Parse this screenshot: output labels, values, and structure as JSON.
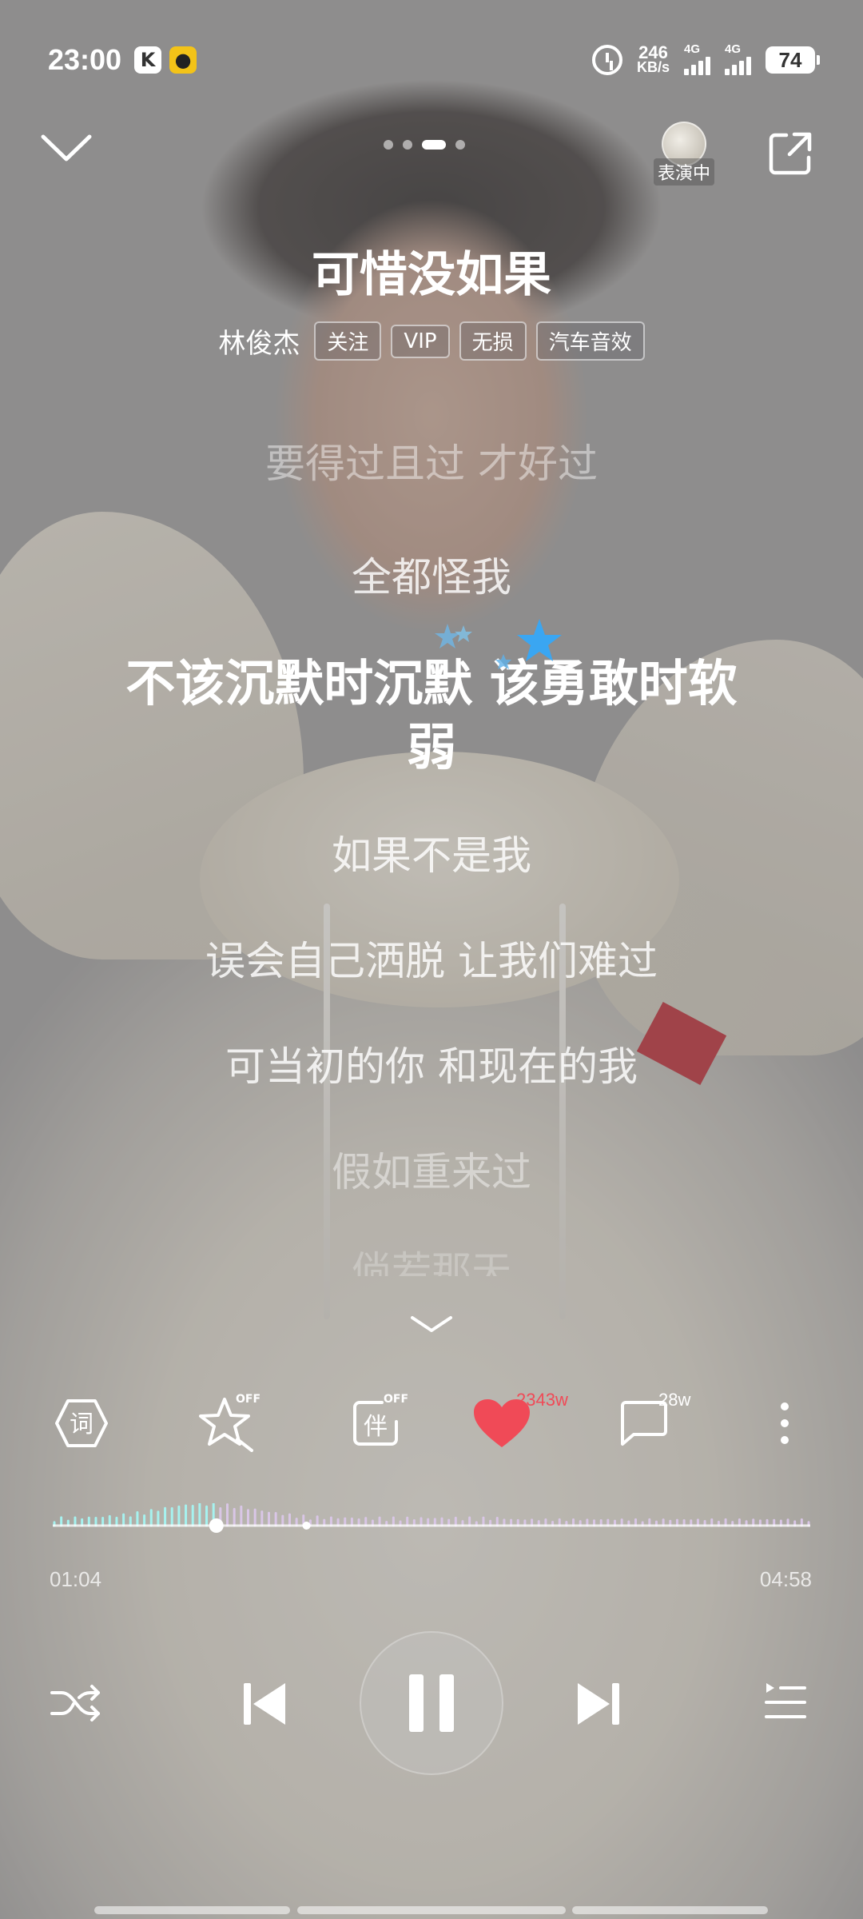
{
  "status_bar": {
    "time": "23:00",
    "app_icons": [
      "K",
      "●"
    ],
    "net_speed_value": "246",
    "net_speed_unit": "KB/s",
    "signal1_label": "4G",
    "signal2_label": "4G",
    "battery": "74"
  },
  "top_bar": {
    "performing_label": "表演中"
  },
  "song": {
    "title": "可惜没如果",
    "artist": "林俊杰",
    "tags": [
      "关注",
      "VIP",
      "无损",
      "汽车音效"
    ]
  },
  "lyrics": {
    "lines": [
      "要得过且过 才好过",
      "全都怪我",
      "不该沉默时沉默 该勇敢时软弱",
      "如果不是我",
      "误会自己洒脱 让我们难过",
      "可当初的你 和现在的我",
      "假如重来过",
      "倘若那天"
    ],
    "current_index": 2
  },
  "actions": {
    "lyrics_icon_char": "词",
    "accompany_icon_char": "伴",
    "off_label": "OFF",
    "like_count": "2343w",
    "comment_count": "28w"
  },
  "progress": {
    "current": "01:04",
    "total": "04:58",
    "fraction": 0.216
  },
  "colors": {
    "like": "#f04a57",
    "wave_played": "#a6f2ef",
    "wave_unplayed": "#d9c6e6",
    "star": "#3aa6f2"
  }
}
